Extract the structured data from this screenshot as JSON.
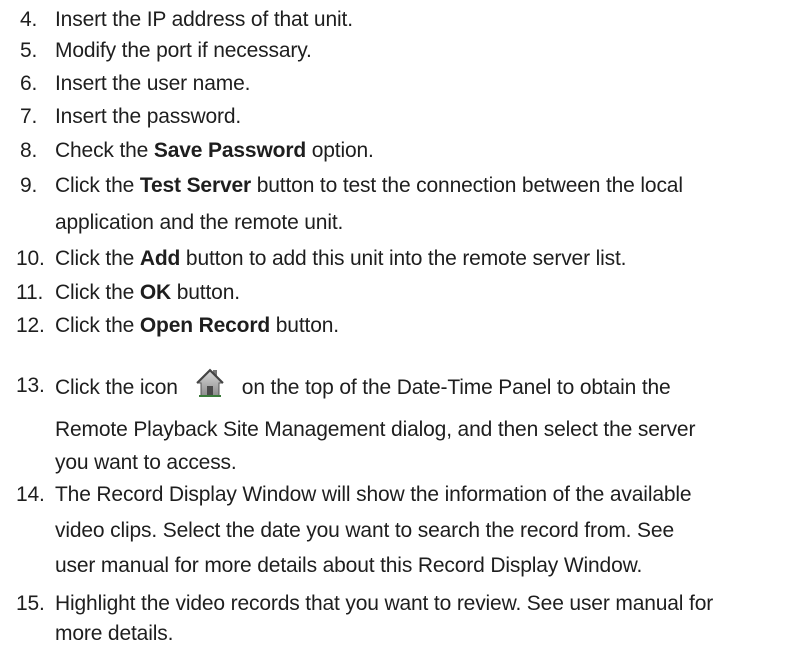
{
  "steps": [
    {
      "num": "4.",
      "parts": [
        {
          "t": "Insert the IP address of that unit."
        }
      ]
    },
    {
      "num": "5.",
      "parts": [
        {
          "t": "Modify the port if necessary."
        }
      ]
    },
    {
      "num": "6.",
      "parts": [
        {
          "t": "Insert the user name."
        }
      ]
    },
    {
      "num": "7.",
      "parts": [
        {
          "t": "Insert the password."
        }
      ]
    },
    {
      "num": "8.",
      "parts": [
        {
          "t": "Check the "
        },
        {
          "t": "Save Password",
          "b": true
        },
        {
          "t": " option."
        }
      ]
    },
    {
      "num": "9.",
      "parts": [
        {
          "t": "Click the "
        },
        {
          "t": "Test Server",
          "b": true
        },
        {
          "t": " button to test the connection between the local"
        }
      ]
    },
    {
      "num": "",
      "parts": [
        {
          "t": "application and the remote unit."
        }
      ]
    },
    {
      "num": "10.",
      "parts": [
        {
          "t": "Click the "
        },
        {
          "t": "Add",
          "b": true
        },
        {
          "t": " button to add this unit into the remote server list."
        }
      ]
    },
    {
      "num": "11.",
      "parts": [
        {
          "t": "Click the "
        },
        {
          "t": "OK",
          "b": true
        },
        {
          "t": " button."
        }
      ]
    },
    {
      "num": "12.",
      "parts": [
        {
          "t": "Click the "
        },
        {
          "t": "Open Record",
          "b": true
        },
        {
          "t": " button."
        }
      ]
    },
    {
      "num": "13.",
      "parts": [
        {
          "t": "Click the icon"
        },
        {
          "icon": "home-icon"
        },
        {
          "t": "on the top of the Date-Time Panel to obtain the"
        }
      ]
    },
    {
      "num": "",
      "parts": [
        {
          "t": "Remote Playback Site Management dialog, and then select the server"
        }
      ]
    },
    {
      "num": "",
      "parts": [
        {
          "t": "you want to access."
        }
      ]
    },
    {
      "num": "14.",
      "parts": [
        {
          "t": "The Record Display Window will show the information of the available"
        }
      ]
    },
    {
      "num": "",
      "parts": [
        {
          "t": "video clips. Select the date you want to search the record from. See"
        }
      ]
    },
    {
      "num": "",
      "parts": [
        {
          "t": "user manual for more details about this Record Display Window."
        }
      ]
    },
    {
      "num": "15.",
      "parts": [
        {
          "t": "Highlight the video records that you want to review. See user manual for"
        }
      ]
    },
    {
      "num": "",
      "parts": [
        {
          "t": "more details."
        }
      ]
    }
  ]
}
